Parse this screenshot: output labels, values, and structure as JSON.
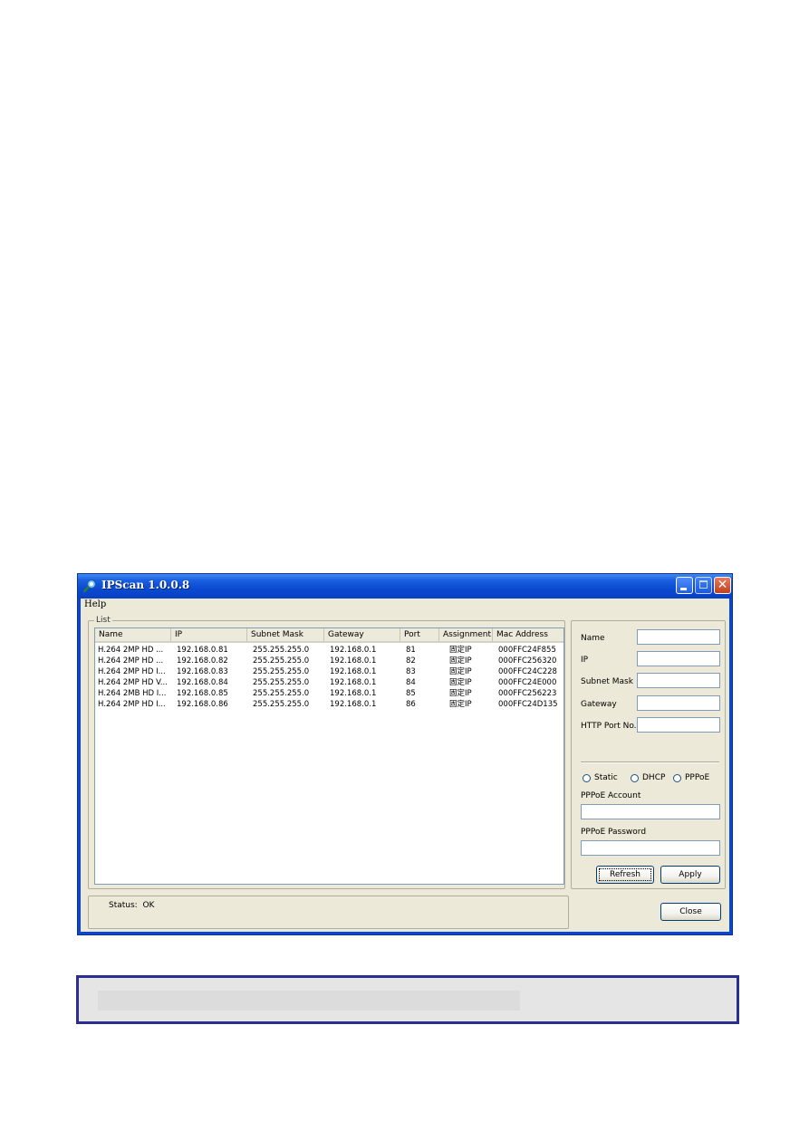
{
  "window": {
    "title": "IPScan 1.0.0.8",
    "close_glyph": "✕"
  },
  "menu": {
    "help": "Help"
  },
  "list": {
    "group_label": "List",
    "columns": [
      "Name",
      "IP",
      "Subnet Mask",
      "Gateway",
      "Port",
      "Assignment",
      "Mac Address"
    ],
    "rows": [
      [
        "H.264 2MP HD ...",
        "192.168.0.81",
        "255.255.255.0",
        "192.168.0.1",
        "81",
        "固定IP",
        "000FFC24F855"
      ],
      [
        "H.264 2MP HD ...",
        "192.168.0.82",
        "255.255.255.0",
        "192.168.0.1",
        "82",
        "固定IP",
        "000FFC256320"
      ],
      [
        "H.264 2MP HD I...",
        "192.168.0.83",
        "255.255.255.0",
        "192.168.0.1",
        "83",
        "固定IP",
        "000FFC24C228"
      ],
      [
        "H.264 2MP HD V...",
        "192.168.0.84",
        "255.255.255.0",
        "192.168.0.1",
        "84",
        "固定IP",
        "000FFC24E000"
      ],
      [
        "H.264 2MB HD I...",
        "192.168.0.85",
        "255.255.255.0",
        "192.168.0.1",
        "85",
        "固定IP",
        "000FFC256223"
      ],
      [
        "H.264 2MP HD I...",
        "192.168.0.86",
        "255.255.255.0",
        "192.168.0.1",
        "86",
        "固定IP",
        "000FFC24D135"
      ]
    ]
  },
  "form": {
    "name_label": "Name",
    "name_value": "",
    "ip_label": "IP",
    "ip_value": "",
    "subnet_label": "Subnet Mask",
    "subnet_value": "",
    "gateway_label": "Gateway",
    "gateway_value": "",
    "http_port_label": "HTTP Port No.",
    "http_port_value": "",
    "radio_static": "Static",
    "radio_dhcp": "DHCP",
    "radio_pppoe": "PPPoE",
    "pppoe_account_label": "PPPoE Account",
    "pppoe_account_value": "",
    "pppoe_password_label": "PPPoE Password",
    "pppoe_password_value": ""
  },
  "buttons": {
    "refresh": "Refresh",
    "apply": "Apply",
    "close": "Close"
  },
  "status": {
    "label": "Status:",
    "value": "OK"
  }
}
